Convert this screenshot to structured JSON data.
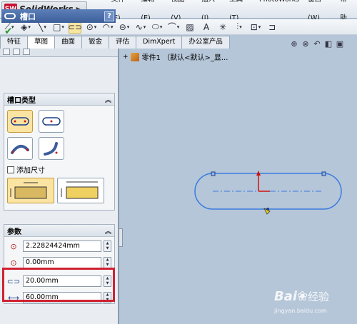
{
  "app": {
    "name": "SolidWorks",
    "logo_text": "SW"
  },
  "menu": [
    "文件(F)",
    "编辑(E)",
    "视图(V)",
    "插入(I)",
    "工具(T)",
    "PhotoWorks",
    "窗口(W)",
    "帮助"
  ],
  "toolbar": {
    "icons": [
      "smart-dimension-icon",
      "line-icon",
      "rectangle-icon",
      "slot-icon",
      "circle-icon",
      "arc-icon",
      "polygon-icon",
      "spline-icon",
      "ellipse-icon",
      "fillet-icon",
      "plane-icon",
      "text-icon",
      "point-icon",
      "mirror-icon",
      "offset-icon",
      "convert-icon",
      "trim-icon"
    ]
  },
  "tabs": [
    "特征",
    "草图",
    "曲面",
    "钣金",
    "评估",
    "DimXpert",
    "办公室产品"
  ],
  "active_tab": "草图",
  "property_manager": {
    "title": "槽口",
    "help": "?",
    "slot_type": {
      "header": "槽口类型"
    },
    "add_dimensions_label": "添加尺寸",
    "parameters": {
      "header": "参数",
      "x_value": "2.22824424mm",
      "y_value": "0.00mm",
      "width_value": "20.00mm",
      "length_value": "60.00mm"
    }
  },
  "tree": {
    "label": "零件1 （默认<默认>_显..."
  },
  "watermark": {
    "brand": "Bai",
    "brand2": "经验",
    "url": "jingyan.baidu.com"
  }
}
